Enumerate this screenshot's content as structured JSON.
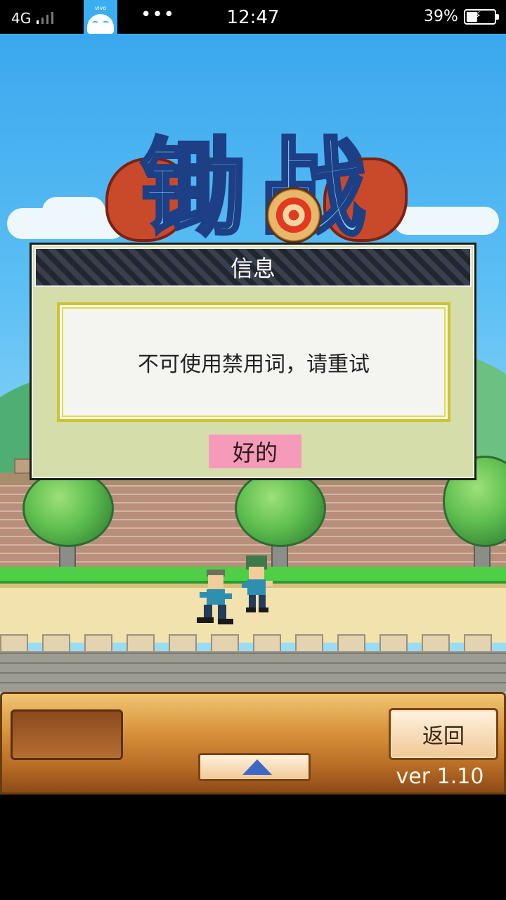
{
  "status_bar": {
    "network": "4G",
    "app_badge_brand": "vivo",
    "more": "•••",
    "time": "12:47",
    "battery_percent": "39%",
    "battery_level": 0.39
  },
  "game": {
    "logo_text": "锄战",
    "dialog": {
      "title": "信息",
      "message": "不可使用禁用词，请重试",
      "ok_label": "好的"
    },
    "panel": {
      "return_label": "返回",
      "version": "ver 1.10"
    }
  },
  "colors": {
    "dialog_bg": "#d5deaa",
    "ok_button": "#f59bb9",
    "sky": "#3aa8ee",
    "panel_wood": "#d7913a"
  }
}
